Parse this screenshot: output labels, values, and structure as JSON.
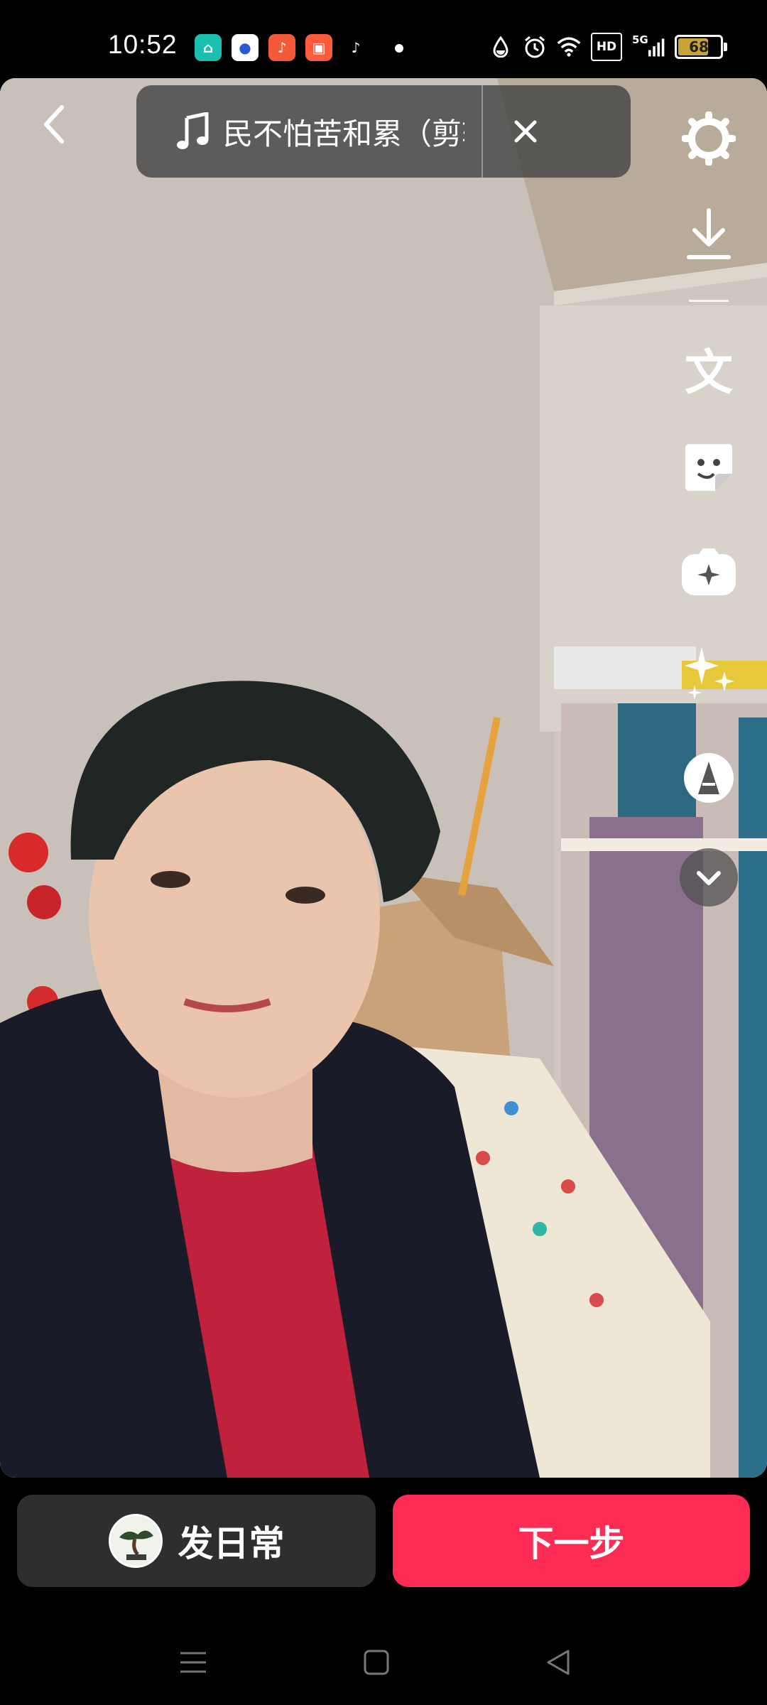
{
  "status_bar": {
    "time": "10:52",
    "network": "5G",
    "hd": "HD",
    "battery": "68",
    "battery_level": 0.68,
    "app_icons": [
      "home-app-icon",
      "baidu-icon",
      "music-app-icon",
      "kuaishou-icon",
      "douyin-lite-icon"
    ]
  },
  "music": {
    "title": "民不怕苦和累（剪辑"
  },
  "side_tools": [
    "settings-icon",
    "download-icon",
    "text-icon",
    "sticker-icon",
    "effects-icon",
    "enhance-icon",
    "filter-icon",
    "more-chevron-icon"
  ],
  "side_text_label": "文",
  "bottom": {
    "daily_label": "发日常",
    "next_label": "下一步"
  },
  "nav": [
    "menu-icon",
    "home-icon",
    "back-icon"
  ],
  "colors": {
    "accent": "#fe2c55",
    "pill_bg": "#464646",
    "daily_bg": "#2e2e2e"
  }
}
